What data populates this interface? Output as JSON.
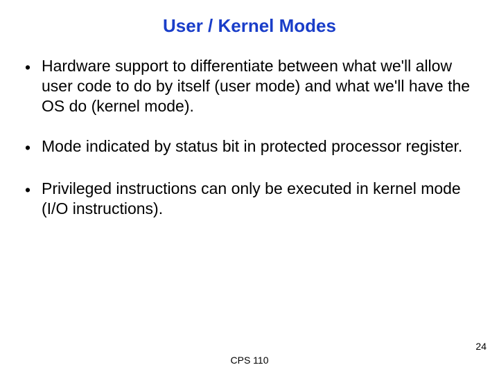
{
  "title": "User / Kernel Modes",
  "bullets": [
    "Hardware support to differentiate between what we'll allow user code to do by itself (user mode) and what we'll have the OS do (kernel mode).",
    "Mode indicated by status bit in protected processor register.",
    "Privileged instructions can only be executed in kernel mode (I/O instructions)."
  ],
  "footer": {
    "course": "CPS 110",
    "page": "24"
  }
}
